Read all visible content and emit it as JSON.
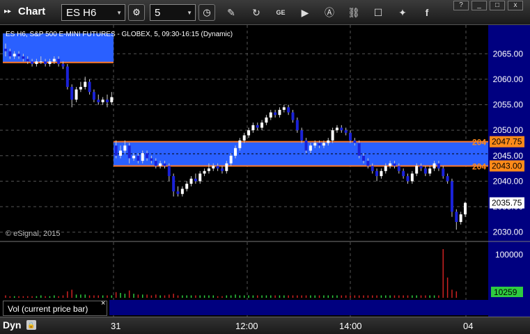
{
  "window": {
    "title": "Chart",
    "symbol": "ES H6",
    "interval": "5",
    "win_buttons": [
      "?",
      "_",
      "□",
      "x"
    ]
  },
  "toolbar_icons": [
    "clock-icon",
    "pencil-icon",
    "refresh-icon",
    "ge-icon",
    "play-icon",
    "a-icon",
    "link-icon",
    "comment-icon",
    "twitter-icon",
    "facebook-icon"
  ],
  "chart": {
    "legend": "ES H6, S&P 500 E-MINI FUTURES - GLOBEX, 5, 09:30-16:15 (Dynamic)",
    "copyright": "© eSignal, 2015",
    "price_ticks": [
      "2065.00",
      "2060.00",
      "2055.00",
      "2050.00",
      "2045.00",
      "2040.00",
      "2035.00",
      "2030.00"
    ],
    "price_ticks_values": [
      2065,
      2060,
      2055,
      2050,
      2045,
      2040,
      2035,
      2030
    ],
    "zone_upper": "2047.75",
    "zone_lower": "2043.00",
    "zone_upper_prefix": "204",
    "zone_lower_prefix": "204",
    "last_price": "2035.75",
    "volume_tick": "100000",
    "volume_last": "10259",
    "vol_panel_label": "Vol (current price bar)",
    "time_labels": [
      "31",
      "12:00",
      "14:00",
      "04"
    ],
    "colors": {
      "zone_fill": "#2a60ff",
      "zone_border": "#ff7a2a",
      "up_candle": "#ffffff",
      "down_candle": "#1a22d8",
      "vol_up": "#2ecc40",
      "vol_down": "#cc2222",
      "price_panel_bg": "#000080"
    }
  },
  "chart_data": {
    "type": "candlestick",
    "ylim": [
      2029,
      2069
    ],
    "candles": [
      [
        2066,
        2065.5,
        2067,
        2064.5
      ],
      [
        2065.5,
        2064.5,
        2066,
        2064
      ],
      [
        2064.5,
        2065,
        2065.5,
        2064
      ],
      [
        2065,
        2064.5,
        2065.5,
        2064
      ],
      [
        2064.5,
        2064,
        2065,
        2063.5
      ],
      [
        2064,
        2063.5,
        2064.5,
        2063
      ],
      [
        2063.5,
        2063,
        2064,
        2062.5
      ],
      [
        2063,
        2063.5,
        2064,
        2062.5
      ],
      [
        2063.5,
        2063.5,
        2064.5,
        2063
      ],
      [
        2063.5,
        2063,
        2064,
        2062.5
      ],
      [
        2063,
        2063.5,
        2064,
        2062.5
      ],
      [
        2063.5,
        2064,
        2064.5,
        2063
      ],
      [
        2064,
        2063,
        2064.5,
        2062.5
      ],
      [
        2063,
        2062.5,
        2063.5,
        2062
      ],
      [
        2062.5,
        2058.5,
        2063,
        2058
      ],
      [
        2058.5,
        2056,
        2059,
        2054.5
      ],
      [
        2056,
        2058,
        2058.5,
        2055.5
      ],
      [
        2058,
        2058.5,
        2059.5,
        2057.5
      ],
      [
        2058.5,
        2059.5,
        2060.5,
        2058
      ],
      [
        2059.5,
        2057.5,
        2060,
        2057
      ],
      [
        2057.5,
        2056,
        2058,
        2055.5
      ],
      [
        2056,
        2055.5,
        2057,
        2055
      ],
      [
        2055.5,
        2056,
        2056.5,
        2055
      ],
      [
        2056,
        2055.5,
        2057,
        2054.5
      ],
      [
        2055.5,
        2056.5,
        2057.5,
        2055
      ],
      [
        2047,
        2045,
        2048,
        2044.5
      ],
      [
        2045,
        2046,
        2047,
        2044.5
      ],
      [
        2046,
        2047,
        2048,
        2045.5
      ],
      [
        2047,
        2044.5,
        2047.5,
        2043.5
      ],
      [
        2044.5,
        2045,
        2045.5,
        2044
      ],
      [
        2045,
        2044,
        2045.5,
        2043.5
      ],
      [
        2044,
        2045.5,
        2046,
        2043.5
      ],
      [
        2045.5,
        2044.5,
        2046,
        2044
      ],
      [
        2044.5,
        2044,
        2045,
        2043.5
      ],
      [
        2044,
        2043,
        2044.5,
        2042.5
      ],
      [
        2043,
        2043.5,
        2044,
        2042.5
      ],
      [
        2043.5,
        2043,
        2044,
        2042.5
      ],
      [
        2043,
        2041,
        2043.5,
        2040
      ],
      [
        2041,
        2038,
        2041.5,
        2037
      ],
      [
        2038,
        2037.5,
        2039,
        2037
      ],
      [
        2037.5,
        2038.5,
        2039,
        2037
      ],
      [
        2038.5,
        2039.5,
        2040,
        2038
      ],
      [
        2039.5,
        2040.5,
        2041,
        2039
      ],
      [
        2040.5,
        2040,
        2041.5,
        2039.5
      ],
      [
        2040,
        2041.5,
        2042,
        2039.5
      ],
      [
        2041.5,
        2042,
        2042.5,
        2041
      ],
      [
        2042,
        2042.5,
        2043.5,
        2041.5
      ],
      [
        2042.5,
        2043,
        2043.5,
        2042
      ],
      [
        2043,
        2042.5,
        2043.5,
        2042
      ],
      [
        2042.5,
        2042,
        2043,
        2041.5
      ],
      [
        2042,
        2043.5,
        2044,
        2041.5
      ],
      [
        2043.5,
        2045,
        2045.5,
        2043
      ],
      [
        2045,
        2046.5,
        2047,
        2044.5
      ],
      [
        2046.5,
        2048,
        2048.5,
        2046
      ],
      [
        2048,
        2049,
        2049.5,
        2047.5
      ],
      [
        2049,
        2050,
        2050.5,
        2048.5
      ],
      [
        2050,
        2051,
        2051.5,
        2049.5
      ],
      [
        2051,
        2050.5,
        2051.5,
        2050
      ],
      [
        2050.5,
        2051.5,
        2052,
        2050
      ],
      [
        2051.5,
        2052.5,
        2053,
        2051
      ],
      [
        2052.5,
        2053.5,
        2054,
        2052
      ],
      [
        2053.5,
        2053,
        2054,
        2052.5
      ],
      [
        2053,
        2054,
        2054.5,
        2052.5
      ],
      [
        2054,
        2054.5,
        2055,
        2053.5
      ],
      [
        2054.5,
        2053.5,
        2055,
        2053
      ],
      [
        2053.5,
        2052,
        2054,
        2051.5
      ],
      [
        2052,
        2050,
        2052.5,
        2049.5
      ],
      [
        2050,
        2048,
        2050.5,
        2047.5
      ],
      [
        2048,
        2046,
        2048.5,
        2045.5
      ],
      [
        2046,
        2047,
        2047.5,
        2045.5
      ],
      [
        2047,
        2047.5,
        2048,
        2046.5
      ],
      [
        2047.5,
        2047,
        2048,
        2046.5
      ],
      [
        2047,
        2047.5,
        2048,
        2046.5
      ],
      [
        2047.5,
        2048,
        2048.5,
        2047
      ],
      [
        2048,
        2050,
        2050.5,
        2047.5
      ],
      [
        2050,
        2050.5,
        2051,
        2049.5
      ],
      [
        2050.5,
        2050,
        2051,
        2049.5
      ],
      [
        2050,
        2049.5,
        2050.5,
        2049
      ],
      [
        2049.5,
        2048,
        2050,
        2047.5
      ],
      [
        2048,
        2047.5,
        2048.5,
        2047
      ],
      [
        2047.5,
        2045,
        2048,
        2044.5
      ],
      [
        2045,
        2044,
        2045.5,
        2043.5
      ],
      [
        2044,
        2043,
        2044.5,
        2042.5
      ],
      [
        2043,
        2042,
        2043.5,
        2041.5
      ],
      [
        2042,
        2041,
        2042.5,
        2040
      ],
      [
        2041,
        2042,
        2042.5,
        2040.5
      ],
      [
        2042,
        2043,
        2043.5,
        2041.5
      ],
      [
        2043,
        2043.5,
        2044,
        2042.5
      ],
      [
        2043.5,
        2043,
        2044,
        2042.5
      ],
      [
        2043,
        2042,
        2043.5,
        2041.5
      ],
      [
        2042,
        2041,
        2042.5,
        2040.5
      ],
      [
        2041,
        2040,
        2041.5,
        2039.5
      ],
      [
        2040,
        2041.5,
        2042,
        2039.5
      ],
      [
        2041.5,
        2043,
        2043.5,
        2041
      ],
      [
        2043,
        2042.5,
        2043.5,
        2042
      ],
      [
        2042.5,
        2041.5,
        2043,
        2041
      ],
      [
        2041.5,
        2042.5,
        2043,
        2041
      ],
      [
        2042.5,
        2043.5,
        2044,
        2042
      ],
      [
        2043.5,
        2042.5,
        2044,
        2042
      ],
      [
        2042.5,
        2041,
        2043,
        2040.5
      ],
      [
        2041,
        2040,
        2041.5,
        2039.5
      ],
      [
        2040,
        2034,
        2040.5,
        2033
      ],
      [
        2034,
        2032,
        2034.5,
        2030.5
      ],
      [
        2032,
        2033.5,
        2034,
        2031.5
      ],
      [
        2033.5,
        2035.75,
        2036,
        2033
      ]
    ],
    "volumes": [
      3,
      2,
      2,
      2,
      2,
      2,
      2,
      2,
      3,
      2,
      2,
      3,
      2,
      3,
      8,
      10,
      4,
      4,
      4,
      3,
      3,
      3,
      3,
      3,
      3,
      7,
      6,
      5,
      9,
      5,
      4,
      4,
      4,
      3,
      4,
      3,
      3,
      4,
      5,
      3,
      3,
      3,
      3,
      3,
      3,
      3,
      3,
      3,
      2,
      2,
      3,
      3,
      4,
      3,
      3,
      3,
      3,
      3,
      3,
      3,
      3,
      3,
      3,
      3,
      3,
      3,
      3,
      3,
      3,
      3,
      3,
      3,
      3,
      3,
      3,
      3,
      3,
      3,
      3,
      3,
      3,
      3,
      3,
      3,
      3,
      3,
      3,
      3,
      3,
      3,
      3,
      3,
      3,
      3,
      3,
      3,
      3,
      3,
      3,
      60,
      25,
      10,
      8
    ]
  }
}
